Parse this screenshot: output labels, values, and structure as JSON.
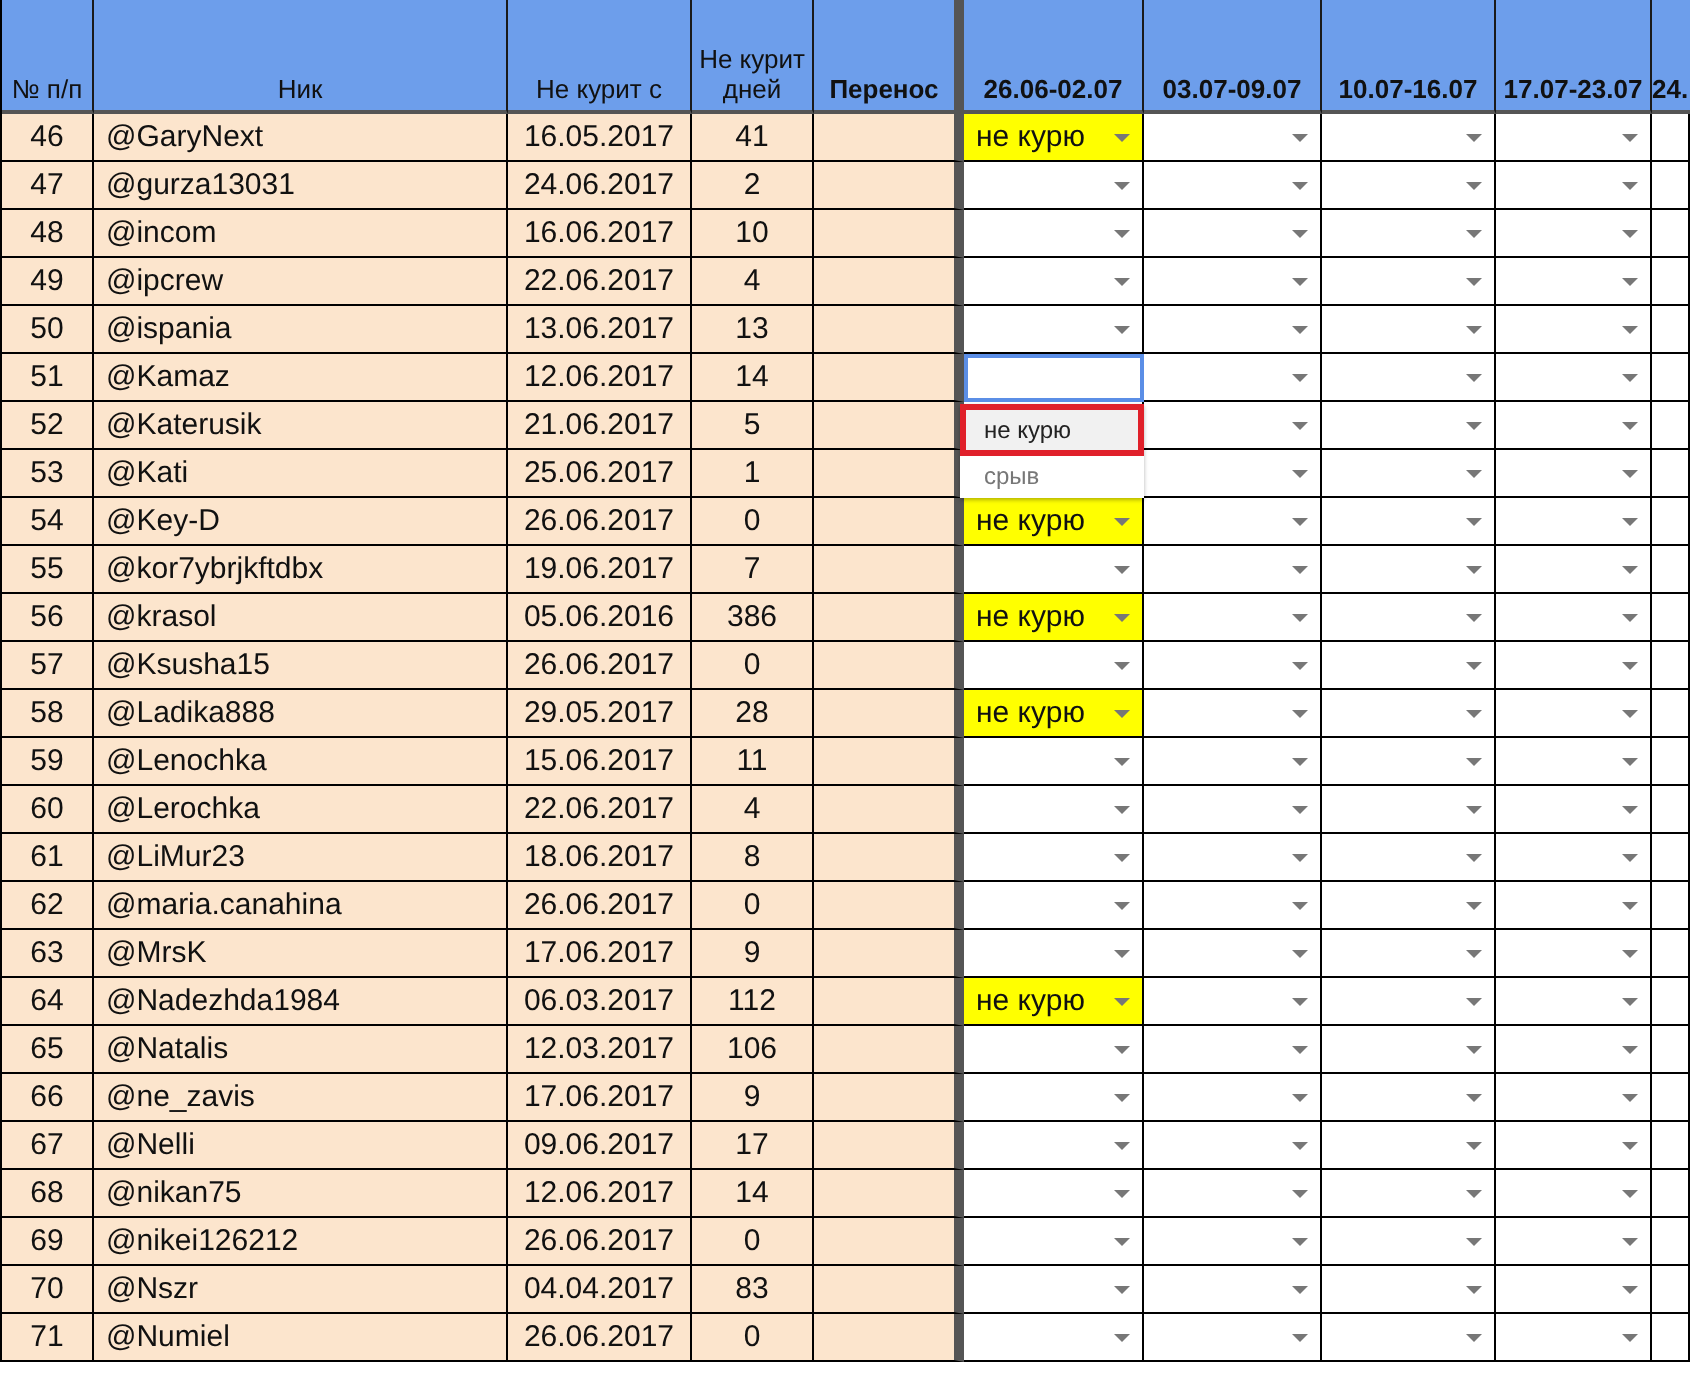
{
  "columns": [
    {
      "label": "№ п/п",
      "bold": false
    },
    {
      "label": "Ник",
      "bold": false
    },
    {
      "label": "Не курит с",
      "bold": false
    },
    {
      "label": "Не курит дней",
      "bold": false
    },
    {
      "label": "Перенос",
      "bold": true
    },
    {
      "label": "26.06-02.07",
      "bold": true
    },
    {
      "label": "03.07-09.07",
      "bold": true
    },
    {
      "label": "10.07-16.07",
      "bold": true
    },
    {
      "label": "17.07-23.07",
      "bold": true
    },
    {
      "label": "24.",
      "bold": true
    }
  ],
  "rows": [
    {
      "number": "46",
      "nick": "@GaryNext",
      "since": "16.05.2017",
      "days": "41",
      "week_1": "не курю"
    },
    {
      "number": "47",
      "nick": "@gurza13031",
      "since": "24.06.2017",
      "days": "2"
    },
    {
      "number": "48",
      "nick": "@incom",
      "since": "16.06.2017",
      "days": "10"
    },
    {
      "number": "49",
      "nick": "@ipcrew",
      "since": "22.06.2017",
      "days": "4"
    },
    {
      "number": "50",
      "nick": "@ispania",
      "since": "13.06.2017",
      "days": "13"
    },
    {
      "number": "51",
      "nick": "@Kamaz",
      "since": "12.06.2017",
      "days": "14",
      "editing": true,
      "dropdown": [
        {
          "label": "не курю",
          "highlighted": true
        },
        {
          "label": "срыв",
          "highlighted": false
        }
      ]
    },
    {
      "number": "52",
      "nick": "@Katerusik",
      "since": "21.06.2017",
      "days": "5"
    },
    {
      "number": "53",
      "nick": "@Kati",
      "since": "25.06.2017",
      "days": "1"
    },
    {
      "number": "54",
      "nick": "@Key-D",
      "since": "26.06.2017",
      "days": "0",
      "week_1": "не курю"
    },
    {
      "number": "55",
      "nick": "@kor7ybrjkftdbx",
      "since": "19.06.2017",
      "days": "7"
    },
    {
      "number": "56",
      "nick": "@krasol",
      "since": "05.06.2016",
      "days": "386",
      "week_1": "не курю"
    },
    {
      "number": "57",
      "nick": "@Ksusha15",
      "since": "26.06.2017",
      "days": "0"
    },
    {
      "number": "58",
      "nick": "@Ladika888",
      "since": "29.05.2017",
      "days": "28",
      "week_1": "не курю"
    },
    {
      "number": "59",
      "nick": "@Lenochka",
      "since": "15.06.2017",
      "days": "11"
    },
    {
      "number": "60",
      "nick": "@Lerochka",
      "since": "22.06.2017",
      "days": "4"
    },
    {
      "number": "61",
      "nick": "@LiMur23",
      "since": "18.06.2017",
      "days": "8"
    },
    {
      "number": "62",
      "nick": "@maria.canahina",
      "since": "26.06.2017",
      "days": "0"
    },
    {
      "number": "63",
      "nick": "@MrsK",
      "since": "17.06.2017",
      "days": "9"
    },
    {
      "number": "64",
      "nick": "@Nadezhda1984",
      "since": "06.03.2017",
      "days": "112",
      "week_1": "не курю"
    },
    {
      "number": "65",
      "nick": "@Natalis",
      "since": "12.03.2017",
      "days": "106"
    },
    {
      "number": "66",
      "nick": "@ne_zavis",
      "since": "17.06.2017",
      "days": "9"
    },
    {
      "number": "67",
      "nick": "@Nelli",
      "since": "09.06.2017",
      "days": "17"
    },
    {
      "number": "68",
      "nick": "@nikan75",
      "since": "12.06.2017",
      "days": "14"
    },
    {
      "number": "69",
      "nick": "@nikei126212",
      "since": "26.06.2017",
      "days": "0"
    },
    {
      "number": "70",
      "nick": "@Nszr",
      "since": "04.04.2017",
      "days": "83"
    },
    {
      "number": "71",
      "nick": "@Numiel",
      "since": "26.06.2017",
      "days": "0"
    }
  ]
}
